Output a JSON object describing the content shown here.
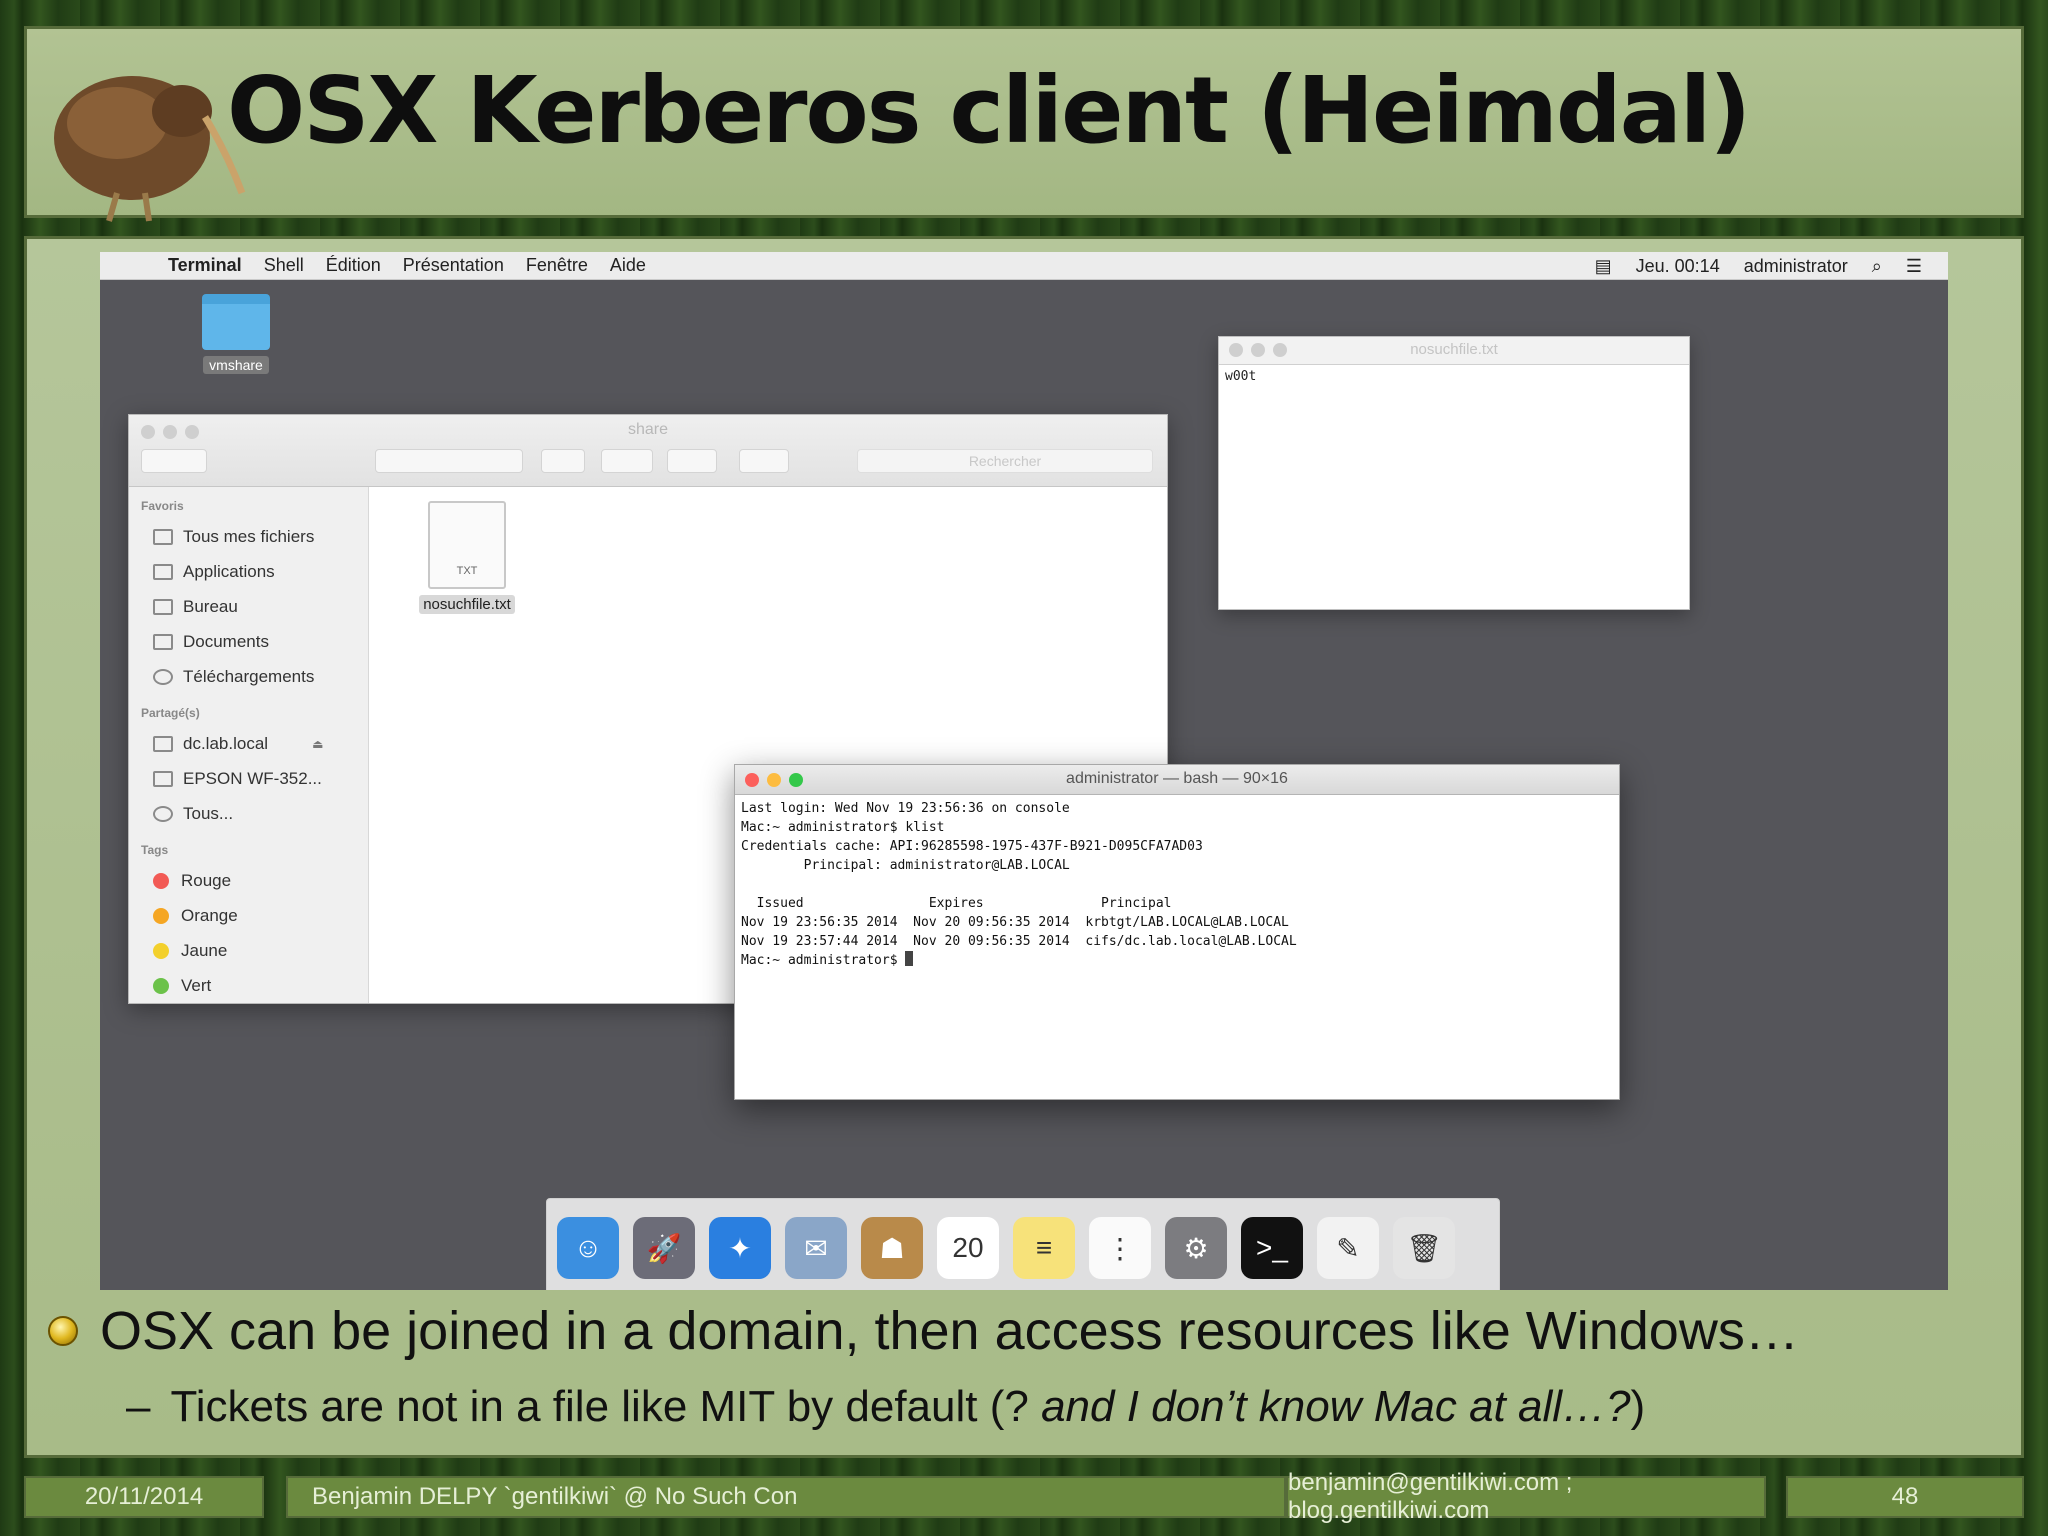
{
  "slide": {
    "title": "OSX Kerberos client (Heimdal)",
    "bullet_main": "OSX can be joined in a domain, then access resources like Windows…",
    "bullet_sub_dash": "–",
    "bullet_sub_normal": "Tickets are not in a file like MIT by default (? ",
    "bullet_sub_italic": "and I don’t know Mac at all…?",
    "bullet_sub_close": ")"
  },
  "footer": {
    "date": "20/11/2014",
    "author": "Benjamin DELPY `gentilkiwi` @ No Such Con",
    "contact": "benjamin@gentilkiwi.com ; blog.gentilkiwi.com",
    "page": "48"
  },
  "menubar": {
    "app": "Terminal",
    "menus": [
      "Shell",
      "Édition",
      "Présentation",
      "Fenêtre",
      "Aide"
    ],
    "clock": "Jeu. 00:14",
    "user": "administrator"
  },
  "desktop": {
    "folder_label": "vmshare"
  },
  "finder": {
    "title": "share",
    "search_placeholder": "Rechercher",
    "favorites_header": "Favoris",
    "favorites": [
      "Tous mes fichiers",
      "Applications",
      "Bureau",
      "Documents",
      "Téléchargements"
    ],
    "shared_header": "Partagé(s)",
    "shared": [
      "dc.lab.local",
      "EPSON WF-352...",
      "Tous..."
    ],
    "tags_header": "Tags",
    "tags": [
      {
        "label": "Rouge",
        "color": "#f25a55"
      },
      {
        "label": "Orange",
        "color": "#f5a623"
      },
      {
        "label": "Jaune",
        "color": "#f3d02c"
      },
      {
        "label": "Vert",
        "color": "#6cc24a"
      }
    ],
    "file_name": "nosuchfile.txt",
    "file_ext": "TXT"
  },
  "textedit": {
    "title": "nosuchfile.txt",
    "content": "w00t"
  },
  "terminal": {
    "title": "administrator — bash — 90×16",
    "lines": [
      "Last login: Wed Nov 19 23:56:36 on console",
      "Mac:~ administrator$ klist",
      "Credentials cache: API:96285598-1975-437F-B921-D095CFA7AD03",
      "        Principal: administrator@LAB.LOCAL",
      "",
      "  Issued                Expires               Principal",
      "Nov 19 23:56:35 2014  Nov 20 09:56:35 2014  krbtgt/LAB.LOCAL@LAB.LOCAL",
      "Nov 19 23:57:44 2014  Nov 20 09:56:35 2014  cifs/dc.lab.local@LAB.LOCAL"
    ],
    "prompt": "Mac:~ administrator$ "
  },
  "dock": {
    "apps": [
      {
        "name": "finder-icon",
        "color": "#3b8fe0",
        "glyph": "☺"
      },
      {
        "name": "launchpad-icon",
        "color": "#6c6c78",
        "glyph": "🚀"
      },
      {
        "name": "safari-icon",
        "color": "#2a7fe0",
        "glyph": "✦"
      },
      {
        "name": "mail-icon",
        "color": "#8aa6c8",
        "glyph": "✉"
      },
      {
        "name": "contacts-icon",
        "color": "#b98a4a",
        "glyph": "☗"
      },
      {
        "name": "calendar-icon",
        "color": "#ffffff",
        "glyph": "20"
      },
      {
        "name": "notes-icon",
        "color": "#f7e27a",
        "glyph": "≡"
      },
      {
        "name": "reminders-icon",
        "color": "#fafafa",
        "glyph": "⋮"
      },
      {
        "name": "system-preferences-icon",
        "color": "#7c7c80",
        "glyph": "⚙"
      },
      {
        "name": "terminal-icon",
        "color": "#111111",
        "glyph": ">_"
      },
      {
        "name": "textedit-icon",
        "color": "#f2f2f2",
        "glyph": "✎"
      },
      {
        "name": "trash-icon",
        "color": "#e4e4e4",
        "glyph": "🗑"
      }
    ]
  }
}
